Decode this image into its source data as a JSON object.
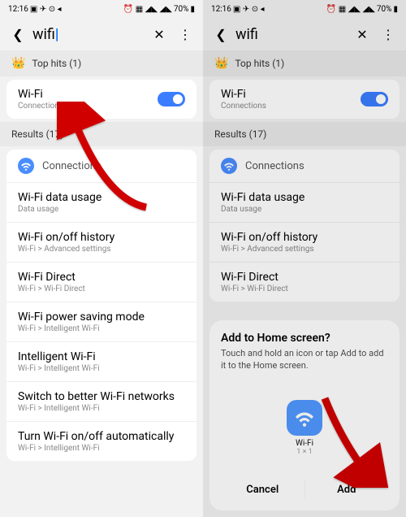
{
  "status": {
    "time": "12:16",
    "battery": "70%"
  },
  "search": {
    "query_left": "wifi",
    "query_right": "wifi"
  },
  "tophits": {
    "label": "Top hits (1)"
  },
  "wifi_row": {
    "title": "Wi-Fi",
    "sub": "Connections"
  },
  "results": {
    "label": "Results (17)"
  },
  "conn": {
    "head": "Connections"
  },
  "rows": [
    {
      "title": "Wi-Fi data usage",
      "sub": "Data usage"
    },
    {
      "title": "Wi-Fi on/off history",
      "sub": "Wi-Fi > Advanced settings"
    },
    {
      "title": "Wi-Fi Direct",
      "sub": "Wi-Fi > Wi-Fi Direct"
    },
    {
      "title": "Wi-Fi power saving mode",
      "sub": "Wi-Fi > Intelligent Wi-Fi"
    },
    {
      "title": "Intelligent Wi-Fi",
      "sub": "Wi-Fi > Intelligent Wi-Fi"
    },
    {
      "title": "Switch to better Wi-Fi networks",
      "sub": "Wi-Fi > Intelligent Wi-Fi"
    },
    {
      "title": "Turn Wi-Fi on/off automatically",
      "sub": "Wi-Fi > Intelligent Wi-Fi"
    }
  ],
  "dialog": {
    "title": "Add to Home screen?",
    "text": "Touch and hold an icon or tap Add to add it to the Home screen.",
    "icon_label": "Wi-Fi",
    "icon_size": "1 × 1",
    "cancel": "Cancel",
    "add": "Add"
  }
}
